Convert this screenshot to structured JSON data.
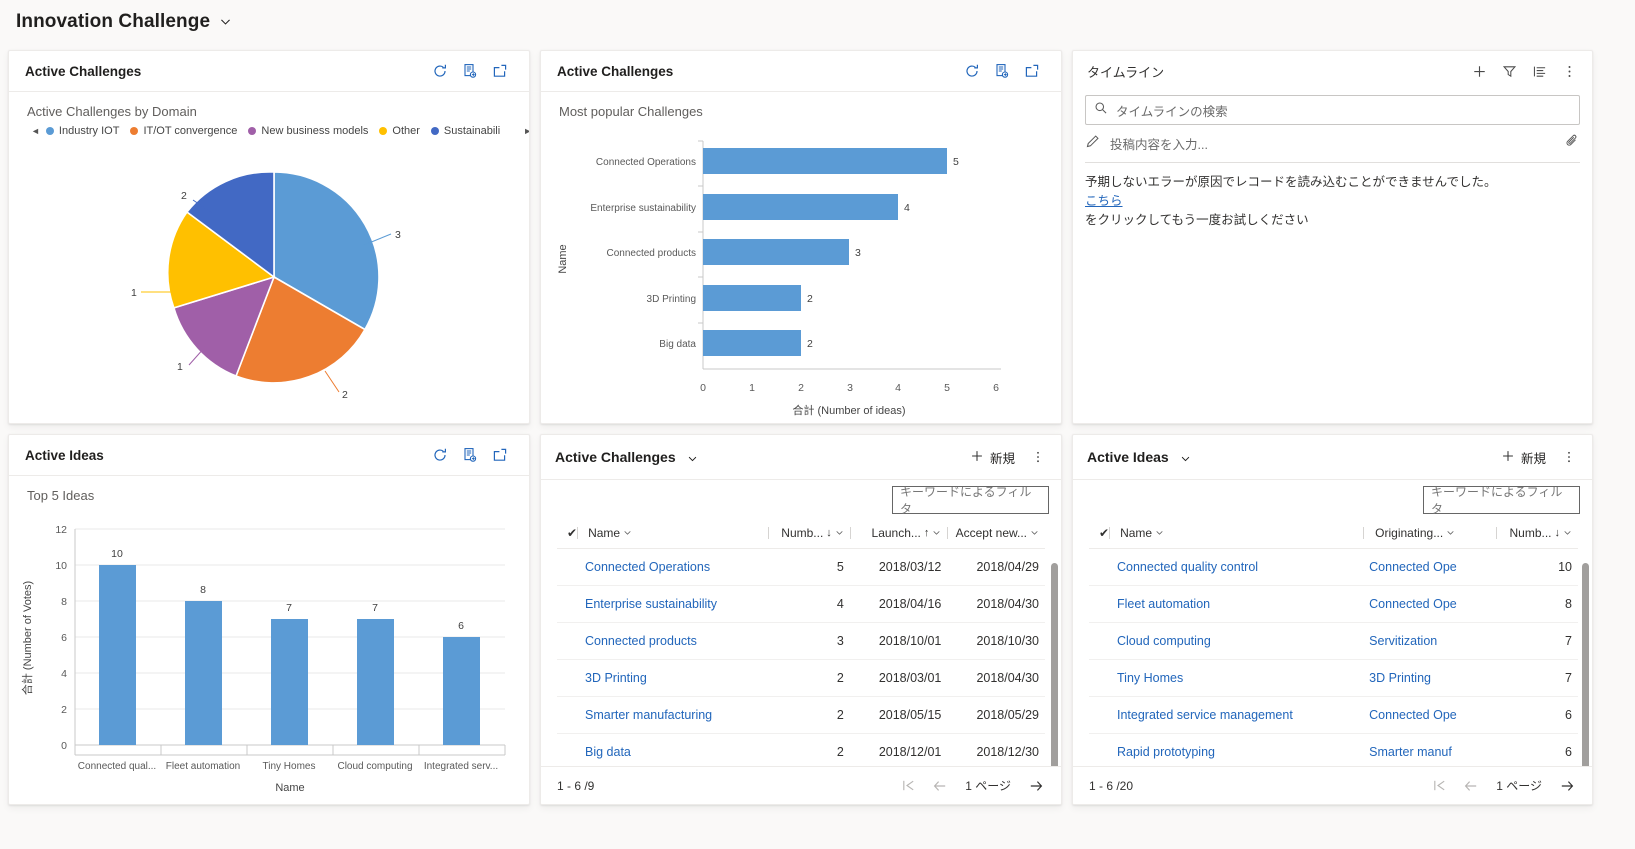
{
  "header": {
    "title": "Innovation Challenge",
    "chevron_icon": "chevron-down-icon"
  },
  "cards": {
    "pie_card": {
      "title": "Active Challenges",
      "chart_title": "Active Challenges by Domain",
      "actions": [
        "refresh-icon",
        "view-records-icon",
        "expand-icon"
      ]
    },
    "bar_card": {
      "title": "Active Challenges",
      "chart_title": "Most popular Challenges",
      "actions": [
        "refresh-icon",
        "view-records-icon",
        "expand-icon"
      ]
    },
    "ideas_card": {
      "title": "Active Ideas",
      "chart_title": "Top 5 Ideas",
      "actions": [
        "refresh-icon",
        "view-records-icon",
        "expand-icon"
      ]
    }
  },
  "timeline": {
    "title": "タイムライン",
    "actions": [
      "plus-icon",
      "filter-icon",
      "sort-list-icon",
      "more-vertical-icon"
    ],
    "search_placeholder": "タイムラインの検索",
    "search_icon": "search-icon",
    "note_placeholder": "投稿内容を入力...",
    "note_icon": "pencil-icon",
    "attach_icon": "paperclip-icon",
    "error_line1": "予期しないエラーが原因でレコードを読み込むことができませんでした。",
    "error_link": "こちら",
    "error_line2": "をクリックしてもう一度お試しください"
  },
  "challenges_grid": {
    "title": "Active Challenges",
    "title_caret": "chevron-down-icon",
    "new_label": "新規",
    "new_icon": "plus-icon",
    "more_icon": "more-vertical-icon",
    "filter_placeholder": "キーワードによるフィルタ",
    "columns": [
      {
        "label": "Name",
        "sort": "",
        "caret": true
      },
      {
        "label": "Numb...",
        "sort": "↓",
        "caret": true
      },
      {
        "label": "Launch...",
        "sort": "↑",
        "caret": true
      },
      {
        "label": "Accept new...",
        "sort": "",
        "caret": true
      }
    ],
    "rows": [
      {
        "name": "Connected Operations",
        "number": "5",
        "launch": "2018/03/12",
        "accept": "2018/04/29"
      },
      {
        "name": "Enterprise sustainability",
        "number": "4",
        "launch": "2018/04/16",
        "accept": "2018/04/30"
      },
      {
        "name": "Connected products",
        "number": "3",
        "launch": "2018/10/01",
        "accept": "2018/10/30"
      },
      {
        "name": "3D Printing",
        "number": "2",
        "launch": "2018/03/01",
        "accept": "2018/04/30"
      },
      {
        "name": "Smarter manufacturing",
        "number": "2",
        "launch": "2018/05/15",
        "accept": "2018/05/29"
      },
      {
        "name": "Big data",
        "number": "2",
        "launch": "2018/12/01",
        "accept": "2018/12/30"
      }
    ],
    "pager": {
      "count": "1 - 6 /9",
      "page_label": "1 ページ"
    }
  },
  "ideas_grid": {
    "title": "Active Ideas",
    "title_caret": "chevron-down-icon",
    "new_label": "新規",
    "new_icon": "plus-icon",
    "more_icon": "more-vertical-icon",
    "filter_placeholder": "キーワードによるフィルタ",
    "columns": [
      {
        "label": "Name",
        "sort": "",
        "caret": true
      },
      {
        "label": "Originating...",
        "sort": "",
        "caret": true
      },
      {
        "label": "Numb...",
        "sort": "↓",
        "caret": true
      }
    ],
    "rows": [
      {
        "name": "Connected quality control",
        "originating": "Connected Ope",
        "number": "10"
      },
      {
        "name": "Fleet automation",
        "originating": "Connected Ope",
        "number": "8"
      },
      {
        "name": "Cloud computing",
        "originating": "Servitization",
        "number": "7"
      },
      {
        "name": "Tiny Homes",
        "originating": "3D Printing",
        "number": "7"
      },
      {
        "name": "Integrated service management",
        "originating": "Connected Ope",
        "number": "6"
      },
      {
        "name": "Rapid prototyping",
        "originating": "Smarter manuf",
        "number": "6"
      }
    ],
    "pager": {
      "count": "1 - 6 /20",
      "page_label": "1 ページ"
    }
  },
  "chart_data": [
    {
      "type": "pie",
      "title": "Active Challenges by Domain",
      "legend_position": "top",
      "labels": [
        "Industry IOT",
        "IT/OT convergence",
        "New business models",
        "Other",
        "Sustainabili"
      ],
      "values": [
        3,
        2,
        1,
        1,
        2
      ],
      "colors": [
        "#5b9bd5",
        "#ed7d31",
        "#a05fa8",
        "#ffc000",
        "#4269c4"
      ],
      "data_labels": [
        "3",
        "2",
        "1",
        "1",
        "2"
      ]
    },
    {
      "type": "bar",
      "orientation": "horizontal",
      "title": "Most popular Challenges",
      "categories": [
        "Connected Operations",
        "Enterprise sustainability",
        "Connected products",
        "3D Printing",
        "Big data"
      ],
      "values": [
        5,
        4,
        3,
        2,
        2
      ],
      "xlabel": "合計 (Number of ideas)",
      "ylabel": "Name",
      "xlim": [
        0,
        6
      ],
      "xticks": [
        "0",
        "1",
        "2",
        "3",
        "4",
        "5",
        "6"
      ],
      "color": "#5b9bd5",
      "grid": false
    },
    {
      "type": "bar",
      "orientation": "vertical",
      "title": "Top 5 Ideas",
      "categories": [
        "Connected qual...",
        "Fleet automation",
        "Tiny Homes",
        "Cloud computing",
        "Integrated serv..."
      ],
      "values": [
        10,
        8,
        7,
        7,
        6
      ],
      "xlabel": "Name",
      "ylabel": "合計 (Number of Votes)",
      "ylim": [
        0,
        12
      ],
      "yticks": [
        "0",
        "2",
        "4",
        "6",
        "8",
        "10",
        "12"
      ],
      "color": "#5b9bd5",
      "grid": true
    }
  ]
}
